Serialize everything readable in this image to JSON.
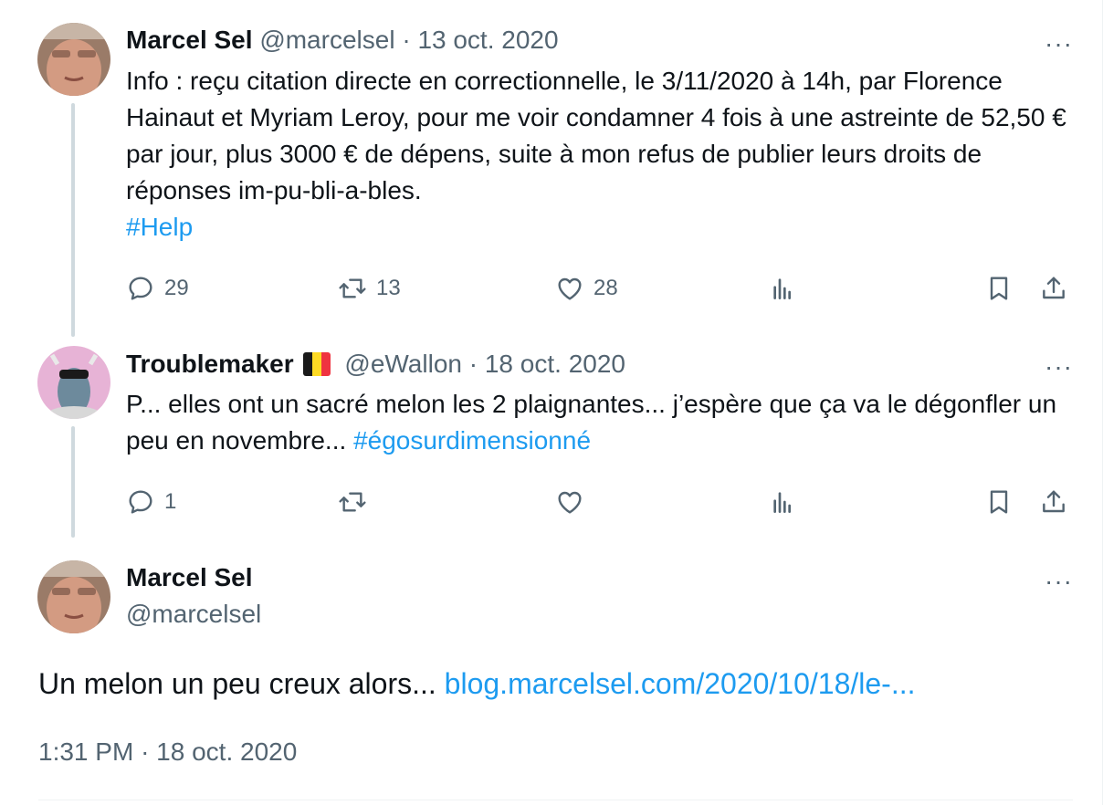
{
  "tweet1": {
    "name": "Marcel Sel",
    "handle": "@marcelsel",
    "separator": "·",
    "date": "13 oct. 2020",
    "text": "Info : reçu citation directe en correctionnelle, le 3/11/2020 à 14h, par Florence Hainaut et Myriam Leroy, pour me voir condamner 4 fois à une astreinte de 52,50 € par jour, plus 3000 € de dépens, suite à mon refus de publier leurs droits de réponses im-pu-bli-a-bles.",
    "hashtag": "#Help",
    "replies": "29",
    "retweets": "13",
    "likes": "28",
    "more": "···"
  },
  "tweet2": {
    "name": "Troublemaker",
    "handle": "@eWallon",
    "separator": "·",
    "date": "18 oct. 2020",
    "text": "P... elles ont un sacré melon les 2 plaignantes... j’espère que ça va le dégonfler un peu en novembre...",
    "hashtag": "#égosurdimensionné",
    "replies": "1",
    "more": "···"
  },
  "main_tweet": {
    "name": "Marcel Sel",
    "handle": "@marcelsel",
    "text": "Un melon un peu creux alors...",
    "link": "blog.marcelsel.com/2020/10/18/le-...",
    "time": "1:31 PM",
    "separator": "·",
    "date": "18 oct. 2020",
    "more": "···"
  },
  "colors": {
    "link": "#1d9bf0",
    "muted": "#536471",
    "text": "#0f1419",
    "thread_line": "#cfd9de",
    "flag": [
      "#1a1a1a",
      "#fdda24",
      "#ef3340"
    ]
  },
  "icons": [
    "reply-icon",
    "retweet-icon",
    "like-icon",
    "views-icon",
    "bookmark-icon",
    "share-icon",
    "more-icon"
  ]
}
